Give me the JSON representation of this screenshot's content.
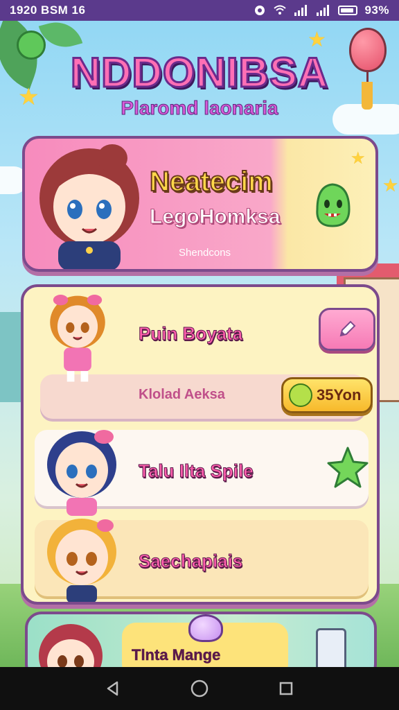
{
  "status_bar": {
    "left": "1920 BSM 16",
    "battery": "93%"
  },
  "header": {
    "title": "NDDONIBSA",
    "subtitle": "Plaromd laonaria"
  },
  "featured": {
    "title": "Neatecim",
    "subtitle": "LegoHomksa",
    "caption": "Shendcons"
  },
  "list": {
    "items": [
      {
        "title": "Puin Boyata",
        "subtitle": "Klolad Aeksa",
        "coin_label": "35Yon"
      },
      {
        "title": "Talu Ilta Spile"
      },
      {
        "title": "Saechapiais"
      }
    ]
  },
  "bottom_card": {
    "label": "Tlnta Mange"
  },
  "colors": {
    "accent_pink": "#f67ab5",
    "frame_purple": "#7c4a8c",
    "status_bar": "#5b3a8c"
  }
}
